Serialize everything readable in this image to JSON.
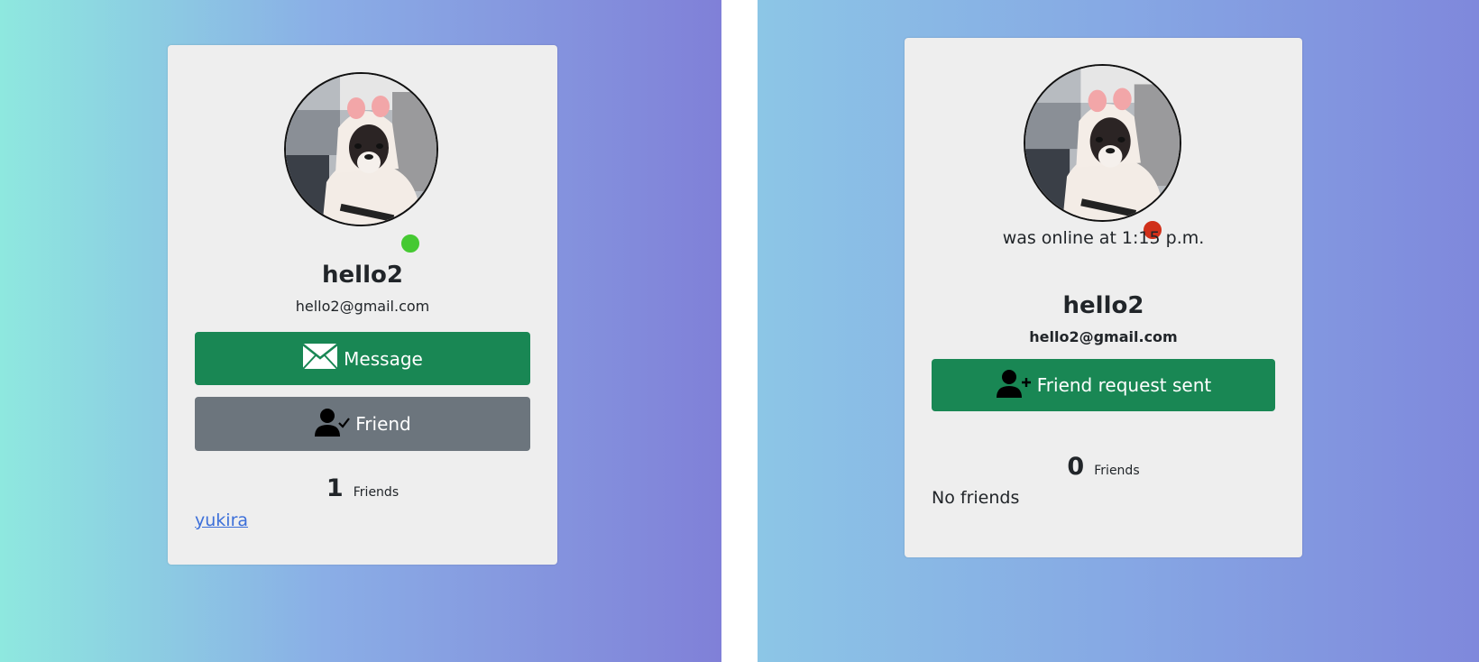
{
  "left_profile": {
    "status": "online",
    "status_color": "#45c932",
    "username": "hello2",
    "email": "hello2@gmail.com",
    "message_button": {
      "label": "Message",
      "icon": "envelope-icon"
    },
    "friend_button": {
      "label": "Friend",
      "icon": "user-check-icon"
    },
    "friends_count": "1",
    "friends_label": "Friends",
    "friends": [
      {
        "name": "yukira"
      }
    ]
  },
  "right_profile": {
    "status": "offline",
    "status_color": "#d0301a",
    "last_seen": "was online at 1:15 p.m.",
    "username": "hello2",
    "email": "hello2@gmail.com",
    "request_button": {
      "label": "Friend request sent",
      "icon": "user-plus-icon"
    },
    "friends_count": "0",
    "friends_label": "Friends",
    "no_friends_text": "No friends"
  },
  "colors": {
    "button_green": "#198754",
    "button_gray": "#6c757d",
    "card_background": "#eeeeee",
    "link": "#3c6fd9"
  }
}
